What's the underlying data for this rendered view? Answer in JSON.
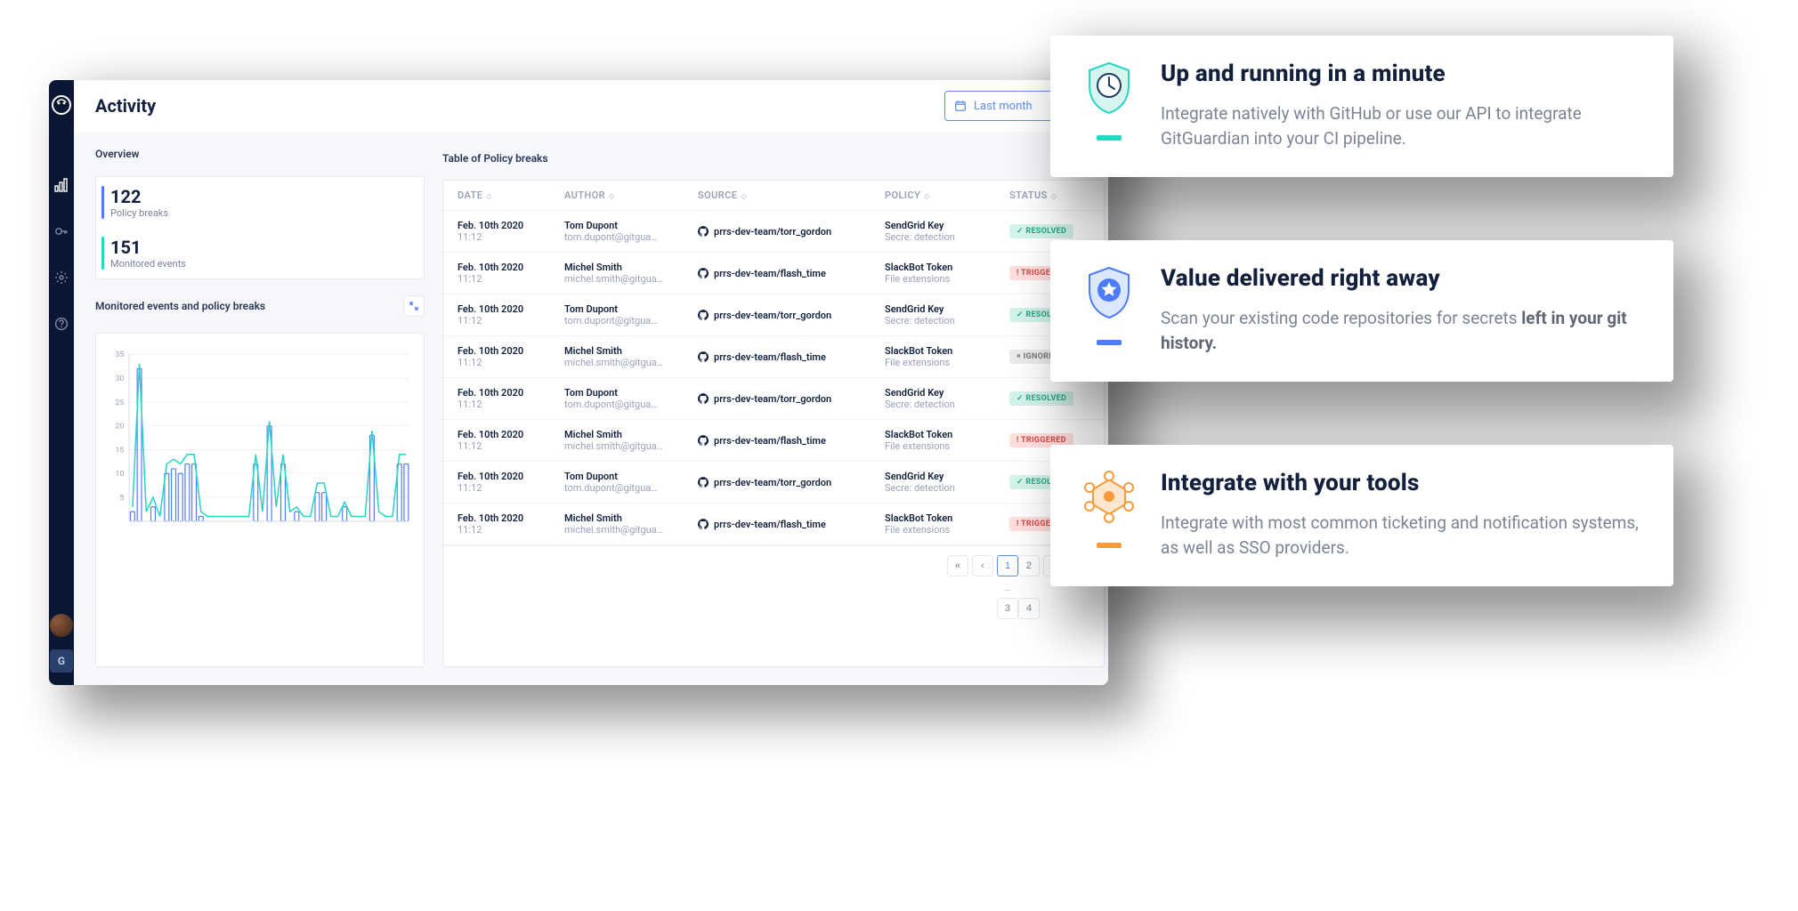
{
  "sidebar": {
    "team_badge": "G"
  },
  "header": {
    "title": "Activity",
    "date_filter": "Last month"
  },
  "overview": {
    "title": "Overview",
    "policy_breaks": {
      "value": "122",
      "label": "Policy breaks"
    },
    "monitored_events": {
      "value": "151",
      "label": "Monitored events"
    }
  },
  "chart": {
    "title": "Monitored events and policy breaks"
  },
  "chart_data": {
    "type": "bar",
    "ylim": [
      0,
      35
    ],
    "yticks": [
      5,
      10,
      15,
      20,
      25,
      30,
      35
    ],
    "series": [
      {
        "name": "Policy breaks",
        "kind": "bar",
        "color": "#4d7cff",
        "values": [
          2,
          32,
          0,
          3,
          0,
          10,
          11,
          10,
          12,
          12,
          1,
          0,
          0,
          0,
          0,
          0,
          0,
          0,
          12,
          0,
          20,
          0,
          12,
          0,
          2,
          0,
          0,
          6,
          6,
          0,
          0,
          3,
          0,
          0,
          0,
          18,
          0,
          0,
          0,
          12,
          12
        ]
      },
      {
        "name": "Monitored events",
        "kind": "line",
        "color": "#29d6c0",
        "values": [
          3,
          33,
          2,
          5,
          1,
          12,
          13,
          12,
          14,
          14,
          2,
          1,
          1,
          1,
          1,
          1,
          1,
          1,
          14,
          2,
          21,
          3,
          14,
          2,
          3,
          1,
          1,
          8,
          8,
          1,
          1,
          4,
          1,
          1,
          1,
          19,
          2,
          1,
          1,
          14,
          14
        ]
      }
    ],
    "title": "Monitored events and policy breaks",
    "xlabel": "",
    "ylabel": ""
  },
  "table": {
    "title": "Table of Policy breaks",
    "columns": [
      "DATE",
      "AUTHOR",
      "SOURCE",
      "POLICY",
      "STATUS"
    ],
    "rows": [
      {
        "date": "Feb. 10th 2020",
        "time": "11:12",
        "author": "Tom Dupont",
        "email": "tom.dupont@gitgua…",
        "source": "prrs-dev-team/torr_gordon",
        "policy": "SendGrid Key",
        "policy_sub": "Secre: detection",
        "status": "RESOLVED"
      },
      {
        "date": "Feb. 10th 2020",
        "time": "11:12",
        "author": "Michel Smith",
        "email": "michel.smith@gitgua…",
        "source": "prrs-dev-team/flash_time",
        "policy": "SlackBot Token",
        "policy_sub": "File extensions",
        "status": "TRIGGERED"
      },
      {
        "date": "Feb. 10th 2020",
        "time": "11:12",
        "author": "Tom Dupont",
        "email": "tom.dupont@gitgua…",
        "source": "prrs-dev-team/torr_gordon",
        "policy": "SendGrid Key",
        "policy_sub": "Secre: detection",
        "status": "RESOLVED"
      },
      {
        "date": "Feb. 10th 2020",
        "time": "11:12",
        "author": "Michel Smith",
        "email": "michel.smith@gitgua…",
        "source": "prrs-dev-team/flash_time",
        "policy": "SlackBot Token",
        "policy_sub": "File extensions",
        "status": "IGNORED"
      },
      {
        "date": "Feb. 10th 2020",
        "time": "11:12",
        "author": "Tom Dupont",
        "email": "tom.dupont@gitgua…",
        "source": "prrs-dev-team/torr_gordon",
        "policy": "SendGrid Key",
        "policy_sub": "Secre: detection",
        "status": "RESOLVED"
      },
      {
        "date": "Feb. 10th 2020",
        "time": "11:12",
        "author": "Michel Smith",
        "email": "michel.smith@gitgua…",
        "source": "prrs-dev-team/flash_time",
        "policy": "SlackBot Token",
        "policy_sub": "File extensions",
        "status": "TRIGGERED"
      },
      {
        "date": "Feb. 10th 2020",
        "time": "11:12",
        "author": "Tom Dupont",
        "email": "tom.dupont@gitgua…",
        "source": "prrs-dev-team/torr_gordon",
        "policy": "SendGrid Key",
        "policy_sub": "Secre: detection",
        "status": "RESOLVED"
      },
      {
        "date": "Feb. 10th 2020",
        "time": "11:12",
        "author": "Michel Smith",
        "email": "michel.smith@gitgua…",
        "source": "prrs-dev-team/flash_time",
        "policy": "SlackBot Token",
        "policy_sub": "File extensions",
        "status": "TRIGGERED"
      }
    ],
    "pages": [
      "1",
      "2",
      "3",
      "4"
    ]
  },
  "features": [
    {
      "title": "Up and running in a minute",
      "body": "Integrate natively with GitHub or use our API to integrate GitGuardian into your CI pipeline.",
      "accent": "#29d6c0"
    },
    {
      "title": "Value delivered right away",
      "body_pre": "Scan your existing code repositories for secrets ",
      "body_bold": "left in your git history.",
      "accent": "#4d7cff"
    },
    {
      "title": "Integrate with your tools",
      "body": "Integrate with most common ticketing and notification systems, as well as SSO providers.",
      "accent": "#f59b3a"
    }
  ]
}
